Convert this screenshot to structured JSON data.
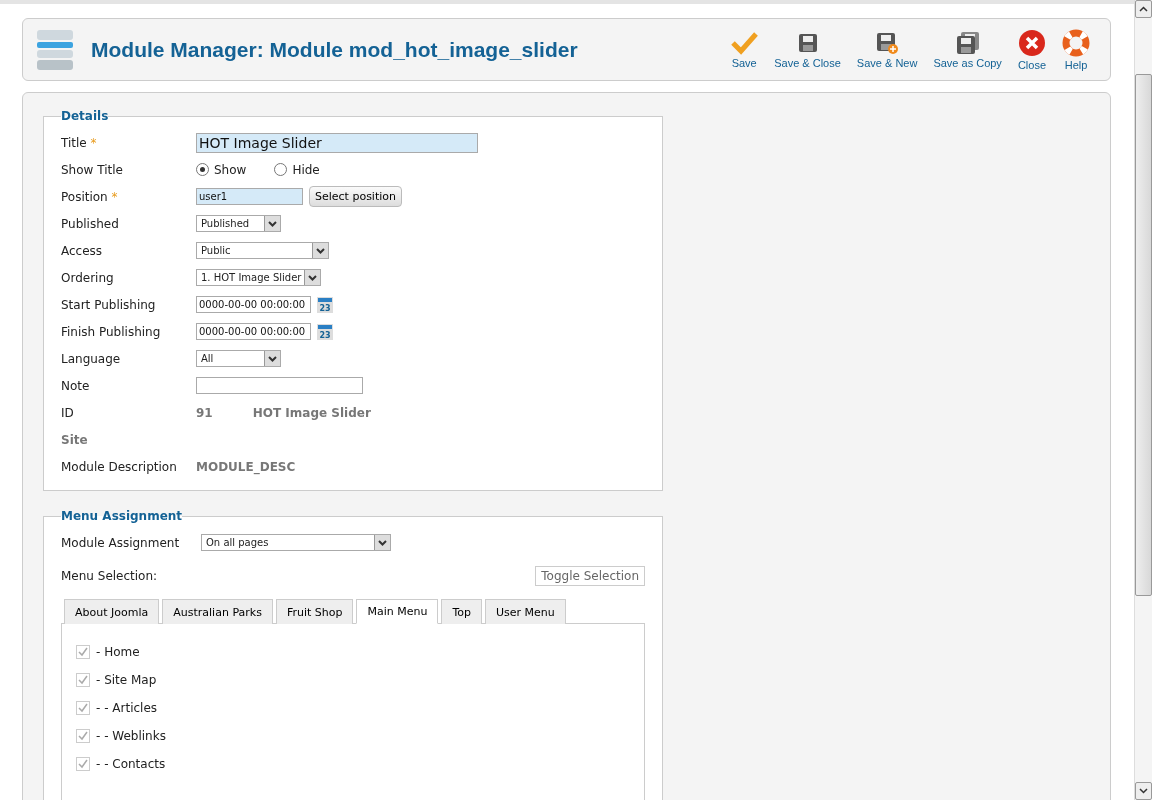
{
  "header": {
    "title": "Module Manager: Module mod_hot_image_slider",
    "toolbar": [
      {
        "label": "Save",
        "kind": "save"
      },
      {
        "label": "Save & Close",
        "kind": "save-close"
      },
      {
        "label": "Save & New",
        "kind": "save-new"
      },
      {
        "label": "Save as Copy",
        "kind": "save-copy"
      },
      {
        "label": "Close",
        "kind": "close"
      },
      {
        "label": "Help",
        "kind": "help"
      }
    ]
  },
  "details": {
    "legend": "Details",
    "fields": [
      {
        "kind": "title",
        "label": "Title",
        "mark": "*",
        "value": "HOT Image Slider"
      },
      {
        "kind": "radio",
        "label": "Show Title",
        "options": [
          {
            "label": "Show",
            "selected": true
          },
          {
            "label": "Hide",
            "selected": false
          }
        ]
      },
      {
        "kind": "position",
        "label": "Position",
        "mark": "*",
        "value": "user1",
        "button": "Select position"
      },
      {
        "kind": "select",
        "label": "Published",
        "value": "Published"
      },
      {
        "kind": "select",
        "label": "Access",
        "value": "Public"
      },
      {
        "kind": "select",
        "label": "Ordering",
        "value": "1. HOT Image Slider"
      },
      {
        "kind": "date",
        "label": "Start Publishing",
        "value": "0000-00-00 00:00:00",
        "calendar_day": "23"
      },
      {
        "kind": "date",
        "label": "Finish Publishing",
        "value": "0000-00-00 00:00:00",
        "calendar_day": "23"
      },
      {
        "kind": "select",
        "label": "Language",
        "value": "All"
      },
      {
        "kind": "text",
        "label": "Note"
      },
      {
        "kind": "info",
        "label": "ID",
        "values": [
          "91",
          "HOT Image Slider"
        ]
      },
      {
        "kind": "heading",
        "label": "Site"
      },
      {
        "kind": "info",
        "label": "Module Description",
        "values": [
          "MODULE_DESC"
        ]
      }
    ]
  },
  "menu_assignment": {
    "legend": "Menu Assignment",
    "assignment_label": "Module Assignment",
    "assignment_value": "On all pages",
    "selection_label": "Menu Selection:",
    "toggle_button": "Toggle Selection",
    "tabs": [
      {
        "label": "About Joomla",
        "selected": false
      },
      {
        "label": "Australian Parks",
        "selected": false
      },
      {
        "label": "Fruit Shop",
        "selected": false
      },
      {
        "label": "Main Menu",
        "selected": true
      },
      {
        "label": "Top",
        "selected": false
      },
      {
        "label": "User Menu",
        "selected": false
      }
    ],
    "items": [
      {
        "label": "- Home",
        "checked": true,
        "disabled": true
      },
      {
        "label": "- Site Map",
        "checked": true,
        "disabled": true
      },
      {
        "label": "- - Articles",
        "checked": true,
        "disabled": true
      },
      {
        "label": "- - Weblinks",
        "checked": true,
        "disabled": true
      },
      {
        "label": "- - Contacts",
        "checked": true,
        "disabled": true
      }
    ]
  }
}
